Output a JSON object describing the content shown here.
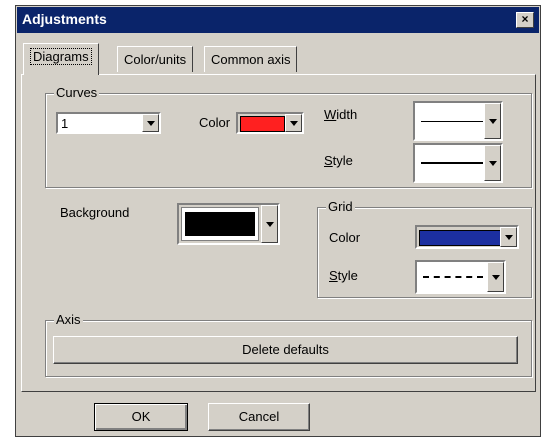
{
  "window": {
    "title": "Adjustments",
    "close_label": "×"
  },
  "tabs": [
    "Diagrams",
    "Color/units",
    "Common axis"
  ],
  "curves": {
    "group_label": "Curves",
    "selected_curve": "1",
    "color_label": "Color",
    "color_value": "#ff2020",
    "width_label_first": "W",
    "width_label_rest": "idth",
    "style_label_first": "S",
    "style_label_rest": "tyle"
  },
  "background": {
    "label": "Background",
    "color_value": "#000000"
  },
  "grid": {
    "group_label": "Grid",
    "color_label": "Color",
    "color_value": "#1c2fa0",
    "style_label_first": "S",
    "style_label_rest": "tyle"
  },
  "axis": {
    "group_label": "Axis",
    "delete_defaults_label": "Delete defaults"
  },
  "footer": {
    "ok_label": "OK",
    "cancel_label": "Cancel"
  }
}
